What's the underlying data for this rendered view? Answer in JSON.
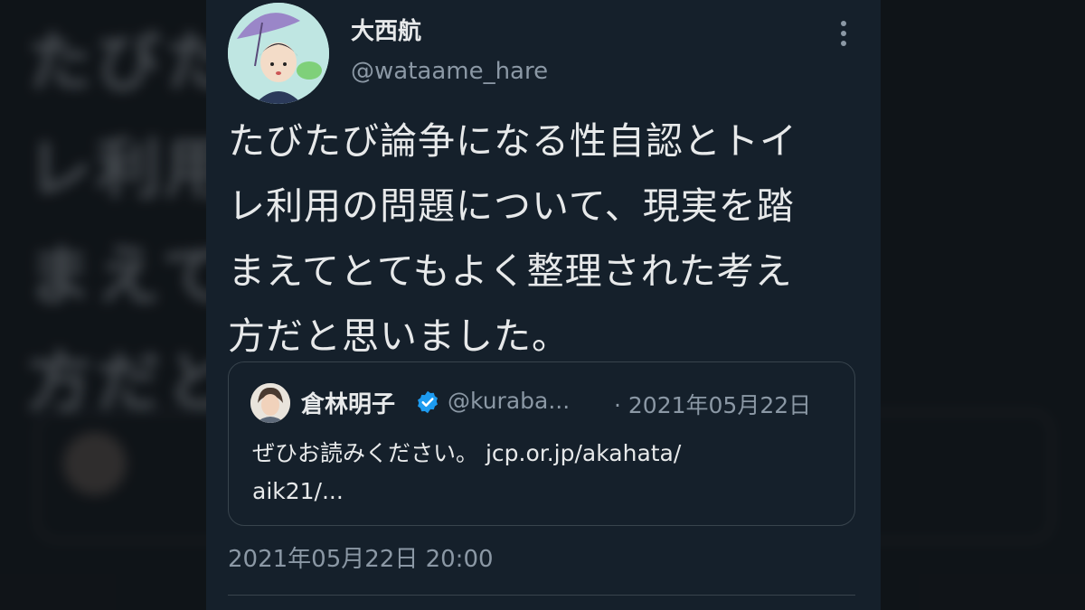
{
  "tweet": {
    "author_name": "大西航",
    "author_handle": "@wataame_hare",
    "text": "たびたび論争になる性自認とトイ\nレ利用の問題について、現実を踏\nまえてとてもよく整理された考え\n方だと思いました。",
    "timestamp": "2021年05月22日 20:00"
  },
  "quoted": {
    "author_name": "倉林明子",
    "author_handle": "@kuraba...",
    "date": "· 2021年05月22日",
    "text": "ぜひお読みください。 jcp.or.jp/akahata/\naik21/..."
  },
  "background": {
    "text": "たびたトイ\nレ利用を踏\nまえて考え\n方だと"
  },
  "icons": {
    "more": "more-vertical-icon",
    "verified": "verified-badge-icon"
  },
  "colors": {
    "card_bg": "#15202b",
    "text": "#e7e9ea",
    "muted": "#8b98a5",
    "border": "#38444d",
    "verified": "#1d9bf0"
  }
}
